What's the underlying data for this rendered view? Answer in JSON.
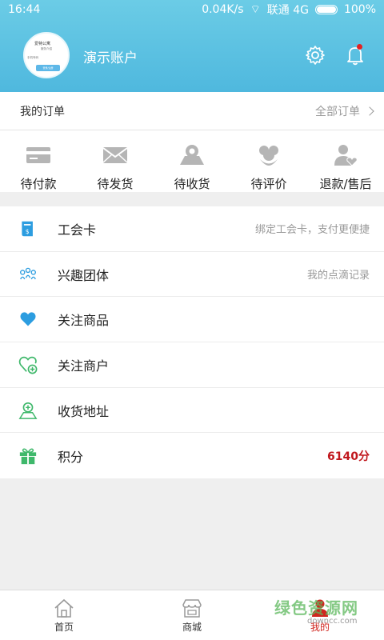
{
  "status_bar": {
    "time": "16:44",
    "network_speed": "0.04K/s",
    "carrier": "联通 4G",
    "battery": "100%"
  },
  "header": {
    "account_name": "演示账户",
    "avatar": {
      "line1": "爱特公寓",
      "line2": "服务介绍",
      "line3": "手机号码",
      "button": "登录/注册"
    },
    "settings_icon": "gear-icon",
    "notification_icon": "bell-icon"
  },
  "orders": {
    "title": "我的订单",
    "all_label": "全部订单",
    "items": [
      {
        "label": "待付款",
        "icon": "card-icon"
      },
      {
        "label": "待发货",
        "icon": "envelope-icon"
      },
      {
        "label": "待收货",
        "icon": "location-map-icon"
      },
      {
        "label": "待评价",
        "icon": "flower-icon"
      },
      {
        "label": "退款/售后",
        "icon": "user-heart-icon"
      }
    ]
  },
  "menu": [
    {
      "label": "工会卡",
      "hint": "绑定工会卡，支付更便捷",
      "icon": "union-card-icon"
    },
    {
      "label": "兴趣团体",
      "hint": "我的点滴记录",
      "icon": "group-icon"
    },
    {
      "label": "关注商品",
      "hint": "",
      "icon": "heart-icon"
    },
    {
      "label": "关注商户",
      "hint": "",
      "icon": "heart-plus-icon"
    },
    {
      "label": "收货地址",
      "hint": "",
      "icon": "address-pin-icon"
    },
    {
      "label": "积分",
      "hint": "6140分",
      "icon": "gift-icon"
    }
  ],
  "tabbar": {
    "items": [
      {
        "label": "首页",
        "icon": "home-icon"
      },
      {
        "label": "商城",
        "icon": "store-icon"
      },
      {
        "label": "我的",
        "icon": "user-icon"
      }
    ],
    "watermark": "绿色资源网",
    "watermark_url": "downcc.com"
  },
  "colors": {
    "header_bg": "#56bde2",
    "accent_red": "#c0171d",
    "icon_blue": "#2c9de0",
    "icon_green": "#3fb86b",
    "icon_gray": "#b0b0b0"
  }
}
